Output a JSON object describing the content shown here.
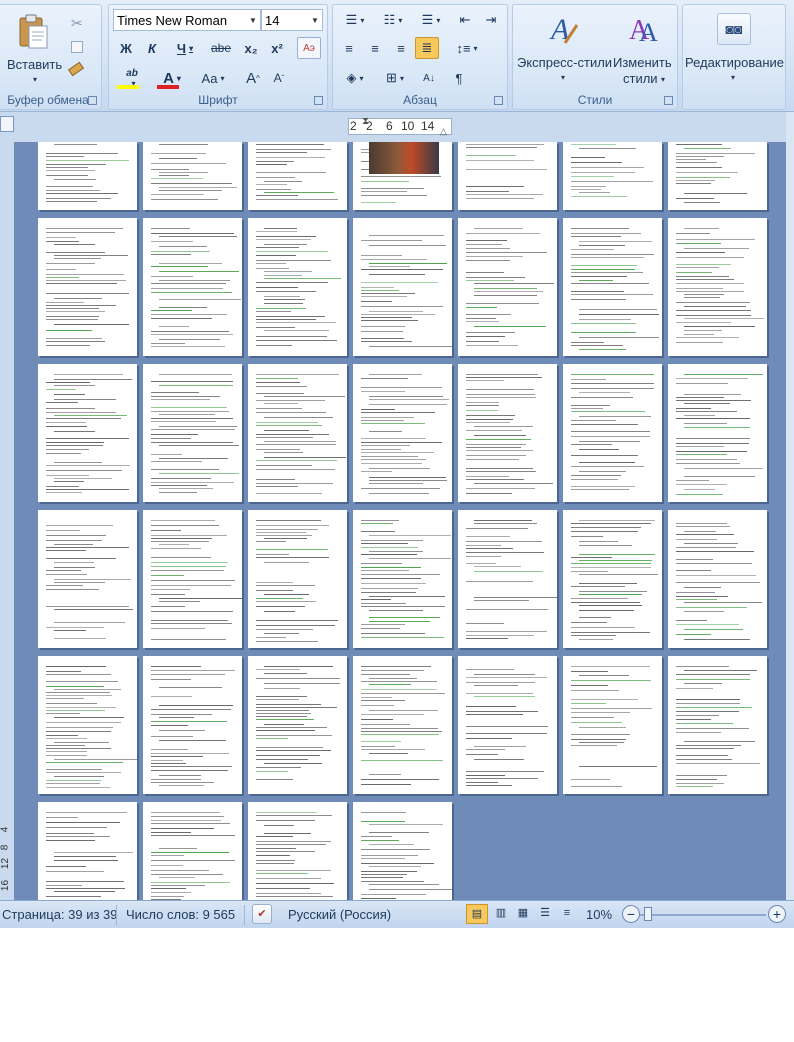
{
  "ribbon": {
    "clipboard": {
      "paste_label": "Вставить",
      "group_label": "Буфер обмена",
      "cut_icon": "scissors-icon",
      "copy_icon": "copy-icon",
      "format_painter_icon": "brush-icon"
    },
    "font": {
      "font_name": "Times New Roman",
      "font_size": "14",
      "bold": "Ж",
      "italic": "К",
      "underline": "Ч",
      "strike": "abe",
      "subscript": "x₂",
      "superscript": "x²",
      "change_case": "Aa",
      "grow": "A",
      "shrink": "A",
      "group_label": "Шрифт",
      "highlight_color": "#ffff00",
      "font_color": "#e02020"
    },
    "paragraph": {
      "group_label": "Абзац",
      "pilcrow": "¶"
    },
    "styles": {
      "express_label": "Экспресс-стили",
      "change_label_1": "Изменить",
      "change_label_2": "стили",
      "group_label": "Стили"
    },
    "editing": {
      "label": "Редактирование"
    }
  },
  "ruler": {
    "ticks": [
      "2",
      "2",
      "6",
      "10",
      "14"
    ]
  },
  "vruler": {
    "ticks": [
      "4",
      "8",
      "12",
      "16"
    ]
  },
  "status": {
    "page": "Страница: 39 из 39",
    "words": "Число слов: 9 565",
    "language": "Русский (Россия)",
    "zoom": "10%"
  },
  "colors": {
    "document_bg": "#6f8bb8",
    "ribbon": "#d5e4f6"
  }
}
